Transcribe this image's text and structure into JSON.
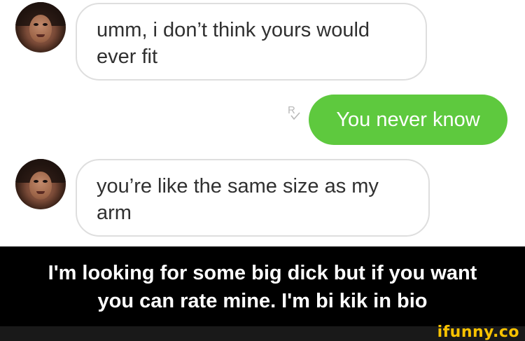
{
  "messages": [
    {
      "direction": "incoming",
      "text": "umm, i don’t think yours would ever fit"
    },
    {
      "direction": "outgoing",
      "text": "You never know",
      "receipt_letter": "R"
    },
    {
      "direction": "incoming",
      "text": "you’re like the same size as my arm"
    }
  ],
  "caption": {
    "line1": "I'm looking for some big dick but if you want",
    "line2": "you can rate mine. I'm bi kik in bio"
  },
  "watermark": "ifunny.co",
  "colors": {
    "outgoing_bubble": "#5ec93e",
    "incoming_border": "#dedede",
    "caption_bg": "#000000",
    "watermark": "#f7c200"
  },
  "icons": [
    "avatar",
    "read-receipt-icon"
  ]
}
